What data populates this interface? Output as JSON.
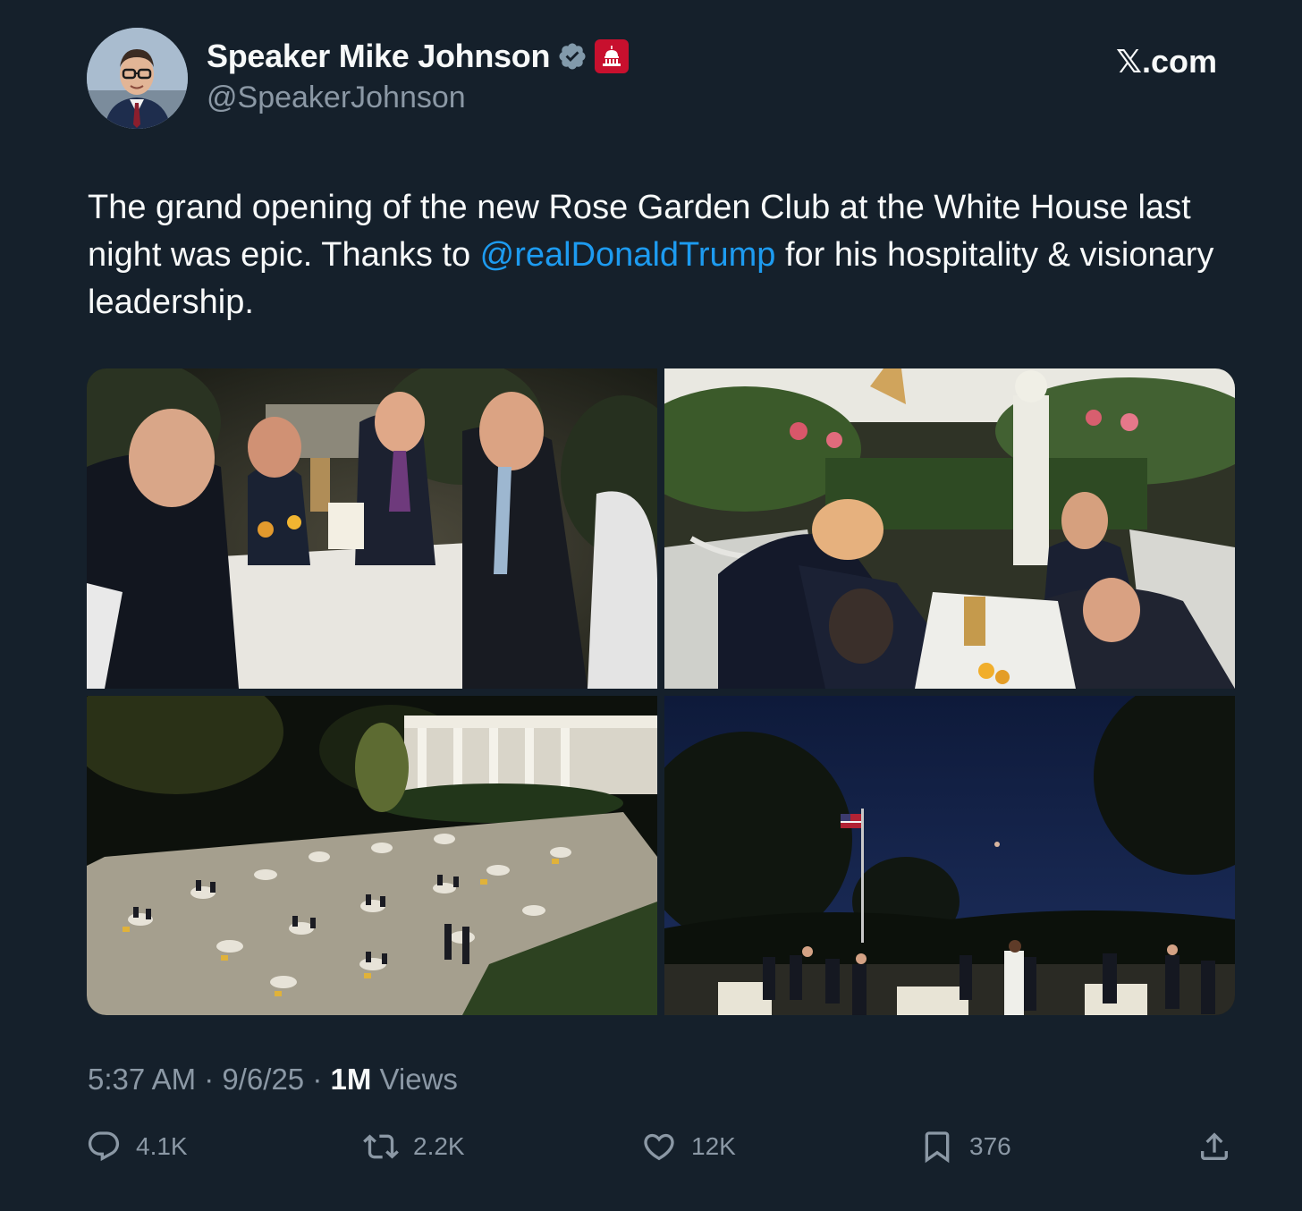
{
  "author": {
    "display_name": "Speaker Mike Johnson",
    "handle": "@SpeakerJohnson",
    "verified_icon": "verified-badge-icon",
    "affiliation_badge": "capitol-badge-icon"
  },
  "site_mark": {
    "x_glyph": "𝕏",
    "domain": ".com"
  },
  "tweet": {
    "text_before": "The grand opening of the new Rose Garden Club at the White House last night was epic. Thanks to ",
    "mention": "@realDonaldTrump",
    "text_after": " for his hospitality & visionary leadership."
  },
  "meta": {
    "time": "5:37 AM",
    "separator": " · ",
    "date": "9/6/25",
    "views_count": "1M",
    "views_label": " Views"
  },
  "actions": {
    "replies": "4.1K",
    "reposts": "2.2K",
    "likes": "12K",
    "bookmarks": "376"
  },
  "colors": {
    "background": "#15202b",
    "text_primary": "#f7f9f9",
    "text_secondary": "#8b98a5",
    "link": "#1d9bf0",
    "verified": "#829aab",
    "badge": "#c8102e"
  }
}
